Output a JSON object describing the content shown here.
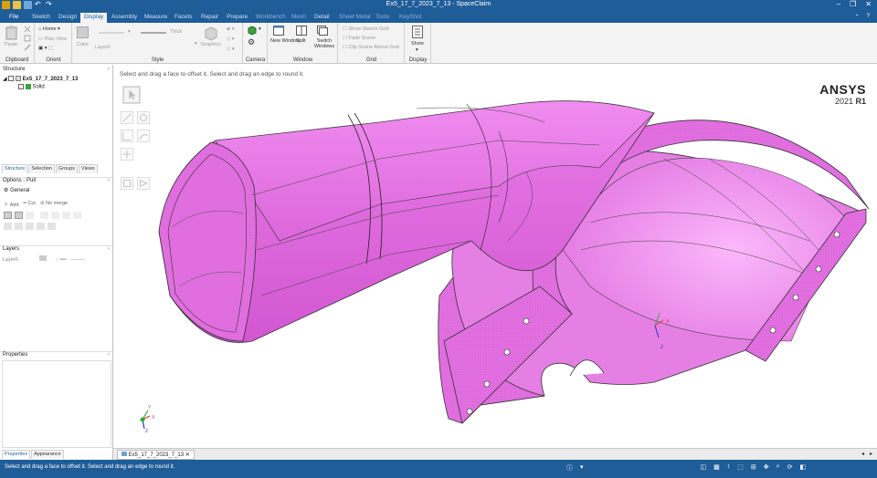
{
  "window": {
    "title": "Ex5_17_7_2023_7_13 - SpaceClaim",
    "controls": [
      "–",
      "❐",
      "✕"
    ]
  },
  "menu": {
    "tabs": [
      "File",
      "Sketch",
      "Design",
      "Display",
      "Assembly",
      "Measure",
      "Facets",
      "Repair",
      "Prepare",
      "Workbench",
      "Mesh",
      "Detail",
      "Sheet Metal",
      "Tools",
      "KeyShot"
    ],
    "active": "Display"
  },
  "ribbon": {
    "clipboard": {
      "label": "Clipboard",
      "paste": "Paste"
    },
    "orient": {
      "label": "Orient",
      "home": "Home",
      "plan_view": "Plan View"
    },
    "style": {
      "label": "Style",
      "color": "Color",
      "thick": "Thick",
      "layer": "Layer0",
      "graphics": "Graphics"
    },
    "camera": {
      "label": "Camera"
    },
    "window": {
      "label": "Window",
      "new_window": "New Window",
      "split": "Split",
      "switch_windows": "Switch Windows"
    },
    "grid": {
      "label": "Grid",
      "show_sketch_grid": "Show Sketch Grid",
      "fade_scene": "Fade Scene",
      "clip_scene": "Clip Scene Above Grid"
    },
    "display": {
      "label": "Display",
      "show": "Show"
    }
  },
  "structure": {
    "title": "Structure",
    "root": "Ex5_17_7_2023_7_13",
    "child": "Solid",
    "tabs": [
      "Structure",
      "Selection",
      "Groups",
      "Views"
    ]
  },
  "options": {
    "title": "Options - Pull",
    "general": "General",
    "add": "Add",
    "cut": "Cut",
    "no_merge": "No merge"
  },
  "layers": {
    "title": "Layers",
    "layer": "Layer0"
  },
  "properties": {
    "title": "Properties",
    "tabs": [
      "Properties",
      "Appearance"
    ]
  },
  "viewport": {
    "hint": "Select and drag a face to offset it. Select and drag an edge to round it.",
    "brand": "ANSYS",
    "version_prefix": "2021",
    "version_suffix": "R1",
    "triad": {
      "x": "X",
      "y": "Y",
      "z": "Z"
    }
  },
  "document_tab": "Ex5_17_7_2023_7_13",
  "status": {
    "text": "Select and drag a face to offset it. Select and drag an edge to round it."
  },
  "colors": {
    "chrome": "#1f5d99",
    "model_fill": "#e77ae6",
    "model_edge": "#2a2a2a"
  }
}
